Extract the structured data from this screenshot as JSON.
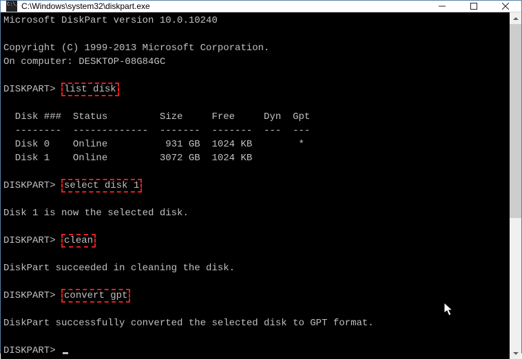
{
  "window": {
    "title": "C:\\Windows\\system32\\diskpart.exe"
  },
  "terminal": {
    "header_line1": "Microsoft DiskPart version 10.0.10240",
    "header_line2": "Copyright (C) 1999-2013 Microsoft Corporation.",
    "header_line3": "On computer: DESKTOP-08G84GC",
    "prompt": "DISKPART>",
    "cmd1": "list disk",
    "table_header": "  Disk ###  Status         Size     Free     Dyn  Gpt",
    "table_divider": "  --------  -------------  -------  -------  ---  ---",
    "table_row0": "  Disk 0    Online          931 GB  1024 KB        *",
    "table_row1": "  Disk 1    Online         3072 GB  1024 KB",
    "cmd2": "select disk 1",
    "msg_selected": "Disk 1 is now the selected disk.",
    "cmd3": "clean",
    "msg_clean": "DiskPart succeeded in cleaning the disk.",
    "cmd4": "convert gpt",
    "msg_convert": "DiskPart successfully converted the selected disk to GPT format."
  }
}
